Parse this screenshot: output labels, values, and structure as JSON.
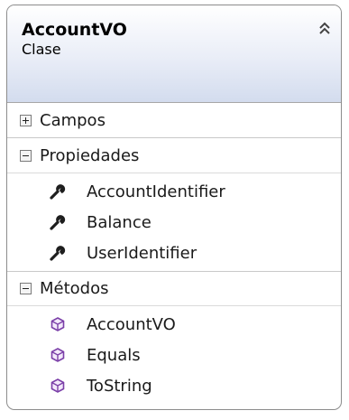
{
  "class_box": {
    "name": "AccountVO",
    "kind": "Clase",
    "sections": [
      {
        "label": "Campos",
        "expanded": false,
        "members": []
      },
      {
        "label": "Propiedades",
        "expanded": true,
        "member_icon": "wrench-icon",
        "members": [
          "AccountIdentifier",
          "Balance",
          "UserIdentifier"
        ]
      },
      {
        "label": "Métodos",
        "expanded": true,
        "member_icon": "method-cube-icon",
        "members": [
          "AccountVO",
          "Equals",
          "ToString"
        ]
      }
    ]
  },
  "colors": {
    "method_icon": "#7b3fa8",
    "header_gradient_end": "#d3dcee"
  }
}
